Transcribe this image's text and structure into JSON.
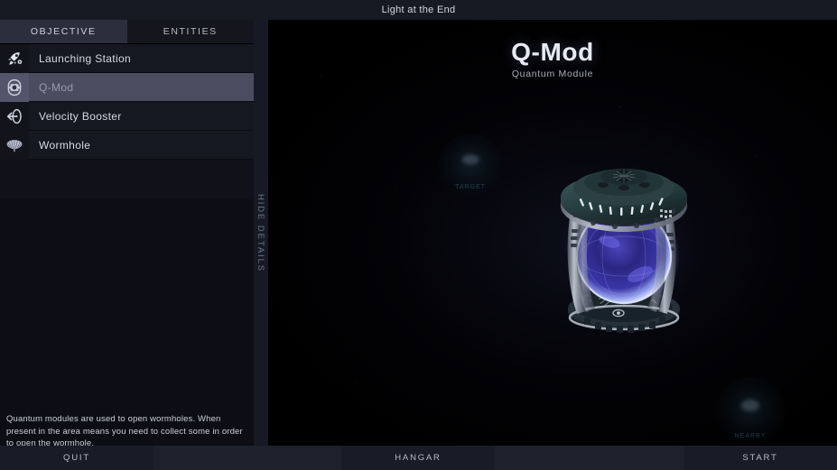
{
  "window": {
    "title": "Light at the End"
  },
  "tabs": [
    {
      "label": "OBJECTIVE",
      "active": true
    },
    {
      "label": "ENTITIES",
      "active": false
    }
  ],
  "sidebar": {
    "items": [
      {
        "label": "Launching Station",
        "icon": "rocket-icon",
        "selected": false
      },
      {
        "label": "Q-Mod",
        "icon": "module-icon",
        "selected": true
      },
      {
        "label": "Velocity Booster",
        "icon": "booster-icon",
        "selected": false
      },
      {
        "label": "Wormhole",
        "icon": "wormhole-icon",
        "selected": false
      }
    ],
    "description": "Quantum modules are used to open wormholes. When present in the area means you need to collect some in order to open the wormhole."
  },
  "rail": {
    "label": "HIDE DETAILS"
  },
  "detail": {
    "title": "Q-Mod",
    "subtitle": "Quantum Module"
  },
  "background": {
    "ghosts": [
      {
        "tag": "TARGET"
      },
      {
        "tag": "NEARBY"
      }
    ]
  },
  "actionbar": {
    "buttons": [
      {
        "label": "QUIT",
        "kind": "action"
      },
      {
        "label": "",
        "kind": "spacer"
      },
      {
        "label": "HANGAR",
        "kind": "action"
      },
      {
        "label": "",
        "kind": "spacer"
      },
      {
        "label": "START",
        "kind": "action"
      }
    ]
  },
  "colors": {
    "titlebar": "#171a23",
    "tab_active": "#2b2e3d",
    "tab_inactive": "#15161d",
    "row_selected": "#4c4c60",
    "rail": "#171a26",
    "sphere_core": "#2a2a86",
    "sphere_glow": "#c9d4ff",
    "dome": "#273a3c",
    "metal": "#aab0bd"
  }
}
